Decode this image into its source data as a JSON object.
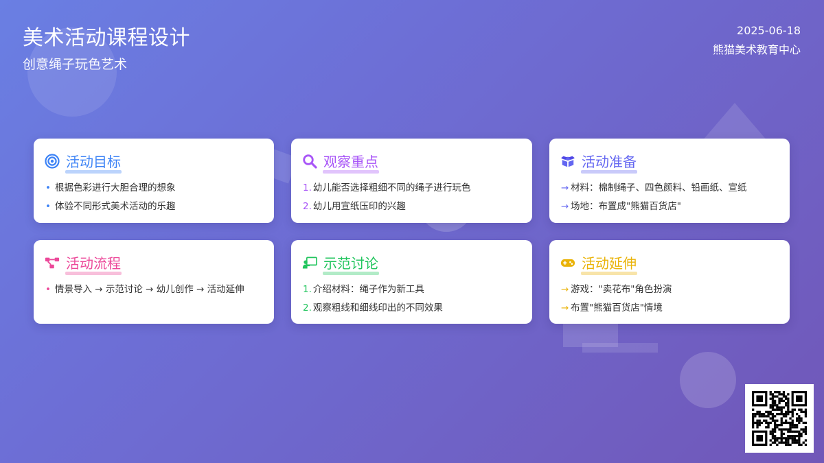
{
  "header": {
    "title": "美术活动课程设计",
    "subtitle": "创意绳子玩色艺术",
    "date": "2025-06-18",
    "org": "熊猫美术教育中心"
  },
  "cards": [
    {
      "title": "活动目标",
      "icon": "target-icon",
      "color": "#3b82f6",
      "marker": "•",
      "items": [
        "根据色彩进行大胆合理的想象",
        "体验不同形式美术活动的乐趣"
      ]
    },
    {
      "title": "观察重点",
      "icon": "search-icon",
      "color": "#a855f7",
      "marker": "numbered",
      "markers": [
        "1.",
        "2."
      ],
      "items": [
        "幼儿能否选择粗细不同的绳子进行玩色",
        "幼儿用宣纸压印的兴趣"
      ]
    },
    {
      "title": "活动准备",
      "icon": "box-open-icon",
      "color": "#6366f1",
      "marker": "→",
      "items": [
        "材料：棉制绳子、四色颜料、铅画纸、宣纸",
        "场地：布置成\"熊猫百货店\""
      ]
    },
    {
      "title": "活动流程",
      "icon": "project-diagram-icon",
      "color": "#ec4899",
      "marker": "•",
      "items": [
        "情景导入 → 示范讨论 → 幼儿创作 → 活动延伸"
      ]
    },
    {
      "title": "示范讨论",
      "icon": "chalkboard-teacher-icon",
      "color": "#22c55e",
      "marker": "numbered",
      "markers": [
        "1.",
        "2."
      ],
      "items": [
        "介绍材料：绳子作为新工具",
        "观察粗线和细线印出的不同效果"
      ]
    },
    {
      "title": "活动延伸",
      "icon": "gamepad-icon",
      "color": "#eab308",
      "marker": "→",
      "items": [
        "游戏：\"卖花布\"角色扮演",
        "布置\"熊猫百货店\"情境"
      ]
    }
  ],
  "qr": {
    "icon": "qr-code-icon"
  }
}
